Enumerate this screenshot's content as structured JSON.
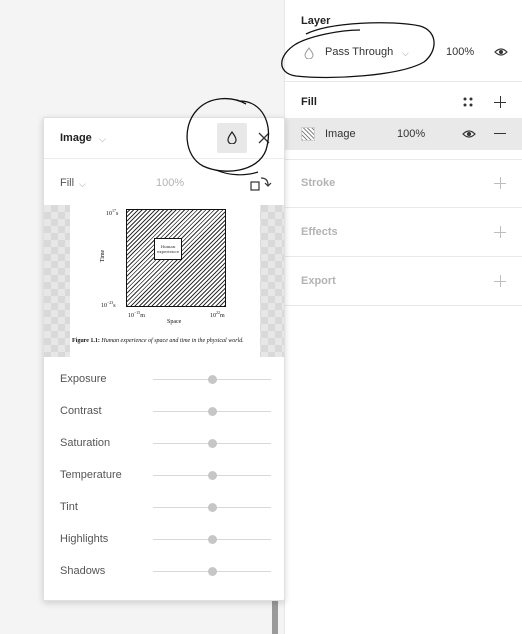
{
  "layer": {
    "title": "Layer",
    "blend_mode": "Pass Through",
    "opacity": "100%",
    "visibility_icon": "eye-icon"
  },
  "fill": {
    "title": "Fill",
    "style_icon": "style-dots-icon",
    "add_icon": "plus-icon",
    "item": {
      "type": "Image",
      "opacity": "100%",
      "visibility_icon": "eye-icon",
      "remove_icon": "minus-icon"
    }
  },
  "stroke": {
    "title": "Stroke"
  },
  "effects": {
    "title": "Effects"
  },
  "export": {
    "title": "Export"
  },
  "popup": {
    "type_label": "Image",
    "fill_mode": "Fill",
    "opacity": "100%",
    "preview": {
      "y_top": "10",
      "y_top_exp": "17",
      "y_top_unit": "s",
      "y_bottom": "10",
      "y_bottom_exp": "−23",
      "y_bottom_unit": "s",
      "x_left": "10",
      "x_left_exp": "−15",
      "x_left_unit": "m",
      "x_right": "10",
      "x_right_exp": "22",
      "x_right_unit": "m",
      "y_axis": "Time",
      "x_axis": "Space",
      "inner_label": "Human experience",
      "caption_bold": "Figure 1.1:",
      "caption_text": "Human experience of space and time in the physical world."
    },
    "adjustments": [
      {
        "label": "Exposure",
        "value": 0
      },
      {
        "label": "Contrast",
        "value": 0
      },
      {
        "label": "Saturation",
        "value": 0
      },
      {
        "label": "Temperature",
        "value": 0
      },
      {
        "label": "Tint",
        "value": 0
      },
      {
        "label": "Highlights",
        "value": 0
      },
      {
        "label": "Shadows",
        "value": 0
      }
    ]
  },
  "colors": {
    "accent_row": "#e9e9e9",
    "muted_text": "#b3b3b3",
    "annotation_ink": "#111111"
  }
}
